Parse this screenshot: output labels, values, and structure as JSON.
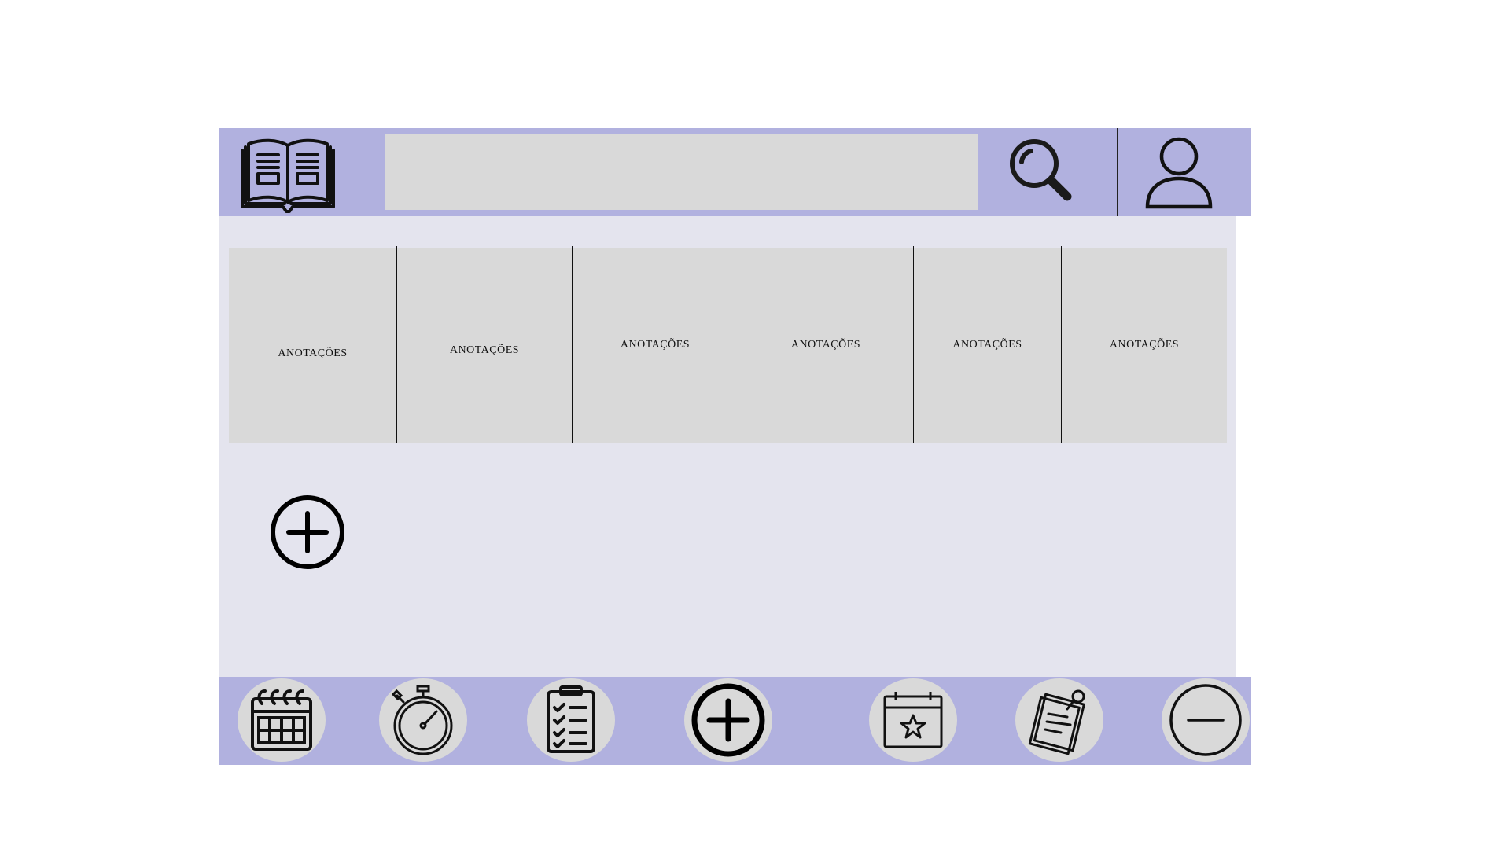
{
  "header": {
    "logo_icon": "open-book-icon",
    "search": {
      "value": "",
      "placeholder": ""
    },
    "search_icon": "magnifier-icon",
    "user_icon": "user-icon"
  },
  "notes": [
    {
      "label": "ANOTAÇÕES"
    },
    {
      "label": "ANOTAÇÕES"
    },
    {
      "label": "ANOTAÇÕES"
    },
    {
      "label": "ANOTAÇÕES"
    },
    {
      "label": "ANOTAÇÕES"
    },
    {
      "label": "ANOTAÇÕES"
    }
  ],
  "main": {
    "add_icon": "plus-circle-icon"
  },
  "bottom_nav": [
    {
      "icon": "calendar-icon"
    },
    {
      "icon": "stopwatch-icon"
    },
    {
      "icon": "checklist-icon"
    },
    {
      "icon": "plus-circle-icon"
    },
    {
      "icon": "calendar-star-icon"
    },
    {
      "icon": "pinned-note-icon"
    },
    {
      "icon": "minus-circle-icon"
    }
  ],
  "colors": {
    "bar": "#b1b1df",
    "panel": "#e4e4ee",
    "card": "#d9d9d9",
    "icon": "#111111"
  }
}
